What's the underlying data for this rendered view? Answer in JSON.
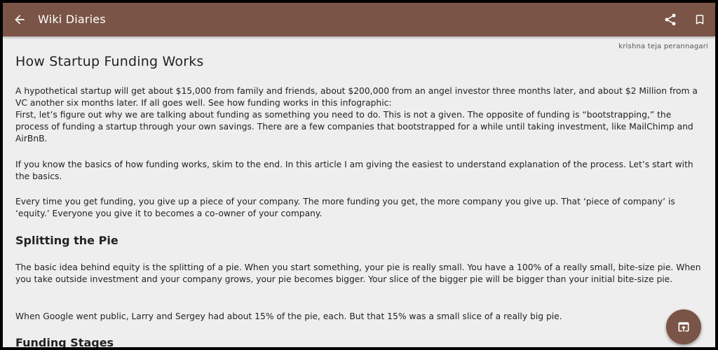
{
  "appbar": {
    "title": "Wiki Diaries",
    "back_icon": "arrow-back-icon",
    "share_icon": "share-icon",
    "bookmark_icon": "bookmark-icon",
    "bg_color": "#7a5446"
  },
  "article": {
    "author": "krishna teja perannagari",
    "title": "How Startup Funding Works",
    "p1": "A hypothetical startup will get about $15,000 from family and friends, about $200,000 from an angel investor three months later, and about $2 Million from a VC another six months later. If all goes well. See how funding works in this infographic:",
    "p2": "First, let’s figure out why we are talking about funding as something you need to do. This is not a given. The opposite of funding is “bootstrapping,” the process of funding a startup through your own savings. There are a few companies that bootstrapped for a while until taking investment, like MailChimp and AirBnB.",
    "p3": "If you know the basics of how funding works, skim to the end. In this article I am giving the easiest to understand explanation of the process. Let’s start with the basics.",
    "p4": "Every time you get funding, you give up a piece of your company. The more funding you get, the more company you give up. That ‘piece of company’ is ‘equity.’ Everyone you give it to becomes a co-owner of your company.",
    "section1_title": "Splitting the Pie",
    "p5": "The basic idea behind equity is the splitting of a pie. When you start something, your pie is really small. You have a 100% of a really small, bite-size pie. When you take outside investment and your company grows, your pie becomes bigger. Your slice of the bigger pie will be bigger than your initial bite-size pie.",
    "p6": "When Google went public, Larry and Sergey had about 15% of the pie, each. But that 15% was a small slice of a really big pie.",
    "section2_title": "Funding Stages"
  },
  "fab": {
    "icon": "open-in-browser-icon"
  }
}
